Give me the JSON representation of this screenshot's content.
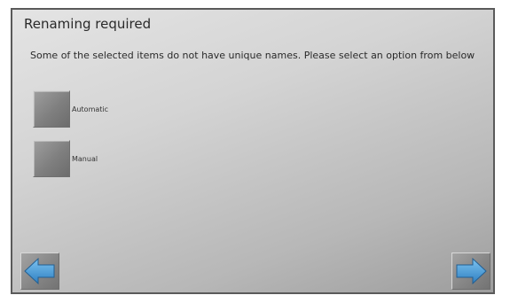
{
  "dialog": {
    "title": "Renaming required",
    "message": "Some of the selected items do not have unique names. Please select an option from below",
    "options": [
      {
        "label": "Automatic"
      },
      {
        "label": "Manual"
      }
    ]
  },
  "navigation": {
    "back_icon": "arrow-left-icon",
    "next_icon": "arrow-right-icon",
    "arrow_color": "#3a8fd0",
    "arrow_highlight": "#7cc3f0"
  }
}
